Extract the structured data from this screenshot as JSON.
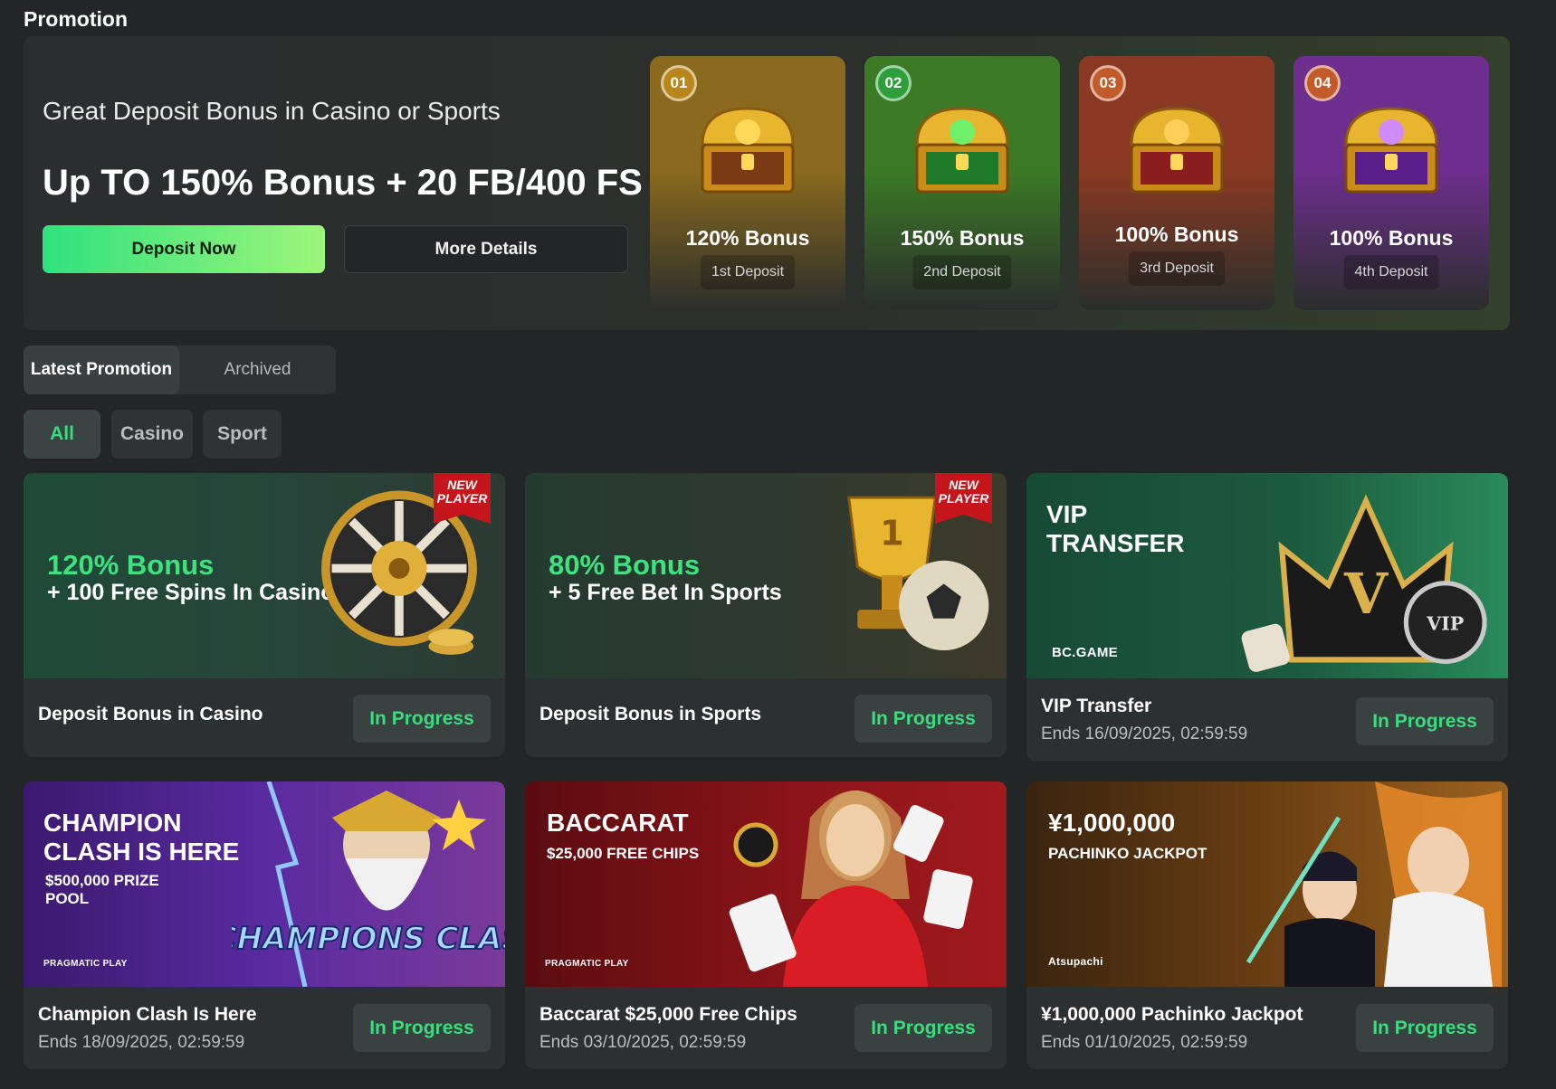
{
  "page": {
    "title": "Promotion"
  },
  "hero": {
    "subtitle": "Great Deposit Bonus in Casino or Sports",
    "headline": "Up TO 150% Bonus + 20 FB/400 FS",
    "deposit_button": "Deposit Now",
    "details_button": "More Details",
    "deposit_cards": [
      {
        "number": "01",
        "bonus": "120% Bonus",
        "label": "1st Deposit",
        "color": "#8a6a1e"
      },
      {
        "number": "02",
        "bonus": "150% Bonus",
        "label": "2nd Deposit",
        "color": "#3c7a25"
      },
      {
        "number": "03",
        "bonus": "100% Bonus",
        "label": "3rd Deposit",
        "color": "#8a3a22"
      },
      {
        "number": "04",
        "bonus": "100% Bonus",
        "label": "4th Deposit",
        "color": "#6e2e8e"
      }
    ]
  },
  "tabs": {
    "active": "Latest Promotion",
    "inactive": "Archived"
  },
  "filters": {
    "all": "All",
    "casino": "Casino",
    "sport": "Sport"
  },
  "status_label": "In Progress",
  "promos": [
    {
      "title": "Deposit Bonus in Casino",
      "date": "",
      "badge": "NEW PLAYER",
      "banner_green": "120% Bonus",
      "banner_white": "+ 100 Free Spins In Casino"
    },
    {
      "title": "Deposit Bonus in Sports",
      "date": "",
      "badge": "NEW PLAYER",
      "banner_green": "80% Bonus",
      "banner_white": "+ 5 Free Bet In Sports"
    },
    {
      "title": "VIP Transfer",
      "date": "Ends 16/09/2025, 02:59:59",
      "banner_head": "VIP TRANSFER",
      "banner_brand": "BC.GAME",
      "banner_letter": "V",
      "banner_vip": "VIP"
    },
    {
      "title": "Champion Clash Is Here",
      "date": "Ends 18/09/2025, 02:59:59",
      "banner_head": "CHAMPION CLASH IS HERE",
      "banner_small": "$500,000 PRIZE POOL",
      "banner_brand": "PRAGMATIC PLAY",
      "banner_logo": "CHAMPIONS CLASH"
    },
    {
      "title": "Baccarat $25,000 Free Chips",
      "date": "Ends 03/10/2025, 02:59:59",
      "banner_head": "BACCARAT",
      "banner_small": "$25,000 FREE CHIPS",
      "banner_brand": "PRAGMATIC PLAY"
    },
    {
      "title": "¥1,000,000 Pachinko Jackpot",
      "date": "Ends 01/10/2025, 02:59:59",
      "banner_head": "¥1,000,000",
      "banner_small": "PACHINKO JACKPOT",
      "banner_brand": "Atsupachi"
    }
  ]
}
